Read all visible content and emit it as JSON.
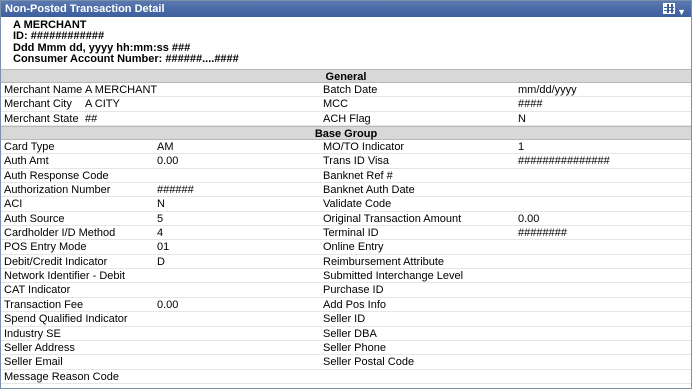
{
  "window": {
    "title": "Non-Posted Transaction Detail"
  },
  "icons": {
    "grid": "grid-icon",
    "menu": "chevron-down-icon"
  },
  "header": {
    "merchant": "A MERCHANT",
    "id_line": "ID: ############",
    "datetime": "Ddd Mmm dd, yyyy hh:mm:ss ###",
    "account_line": "Consumer Account Number: ######....####"
  },
  "general": {
    "title": "General",
    "rows": [
      {
        "l1": "Merchant Name",
        "v1": "A MERCHANT",
        "l2": "Batch Date",
        "v2": "mm/dd/yyyy"
      },
      {
        "l1": "Merchant City",
        "v1": "A CITY",
        "l2": "MCC",
        "v2": "####"
      },
      {
        "l1": "Merchant State",
        "v1": "##",
        "l2": "ACH Flag",
        "v2": "N"
      }
    ]
  },
  "base_group": {
    "title": "Base Group",
    "rows": [
      {
        "l1": "Card Type",
        "v1": "AM",
        "l2": "MO/TO Indicator",
        "v2": "1"
      },
      {
        "l1": "Auth Amt",
        "v1": "0.00",
        "l2": "Trans ID Visa",
        "v2": "###############"
      },
      {
        "l1": "Auth Response Code",
        "v1": "",
        "l2": "Banknet Ref #",
        "v2": ""
      },
      {
        "l1": "Authorization Number",
        "v1": "######",
        "l2": "Banknet Auth Date",
        "v2": ""
      },
      {
        "l1": "ACI",
        "v1": "N",
        "l2": "Validate Code",
        "v2": ""
      },
      {
        "l1": "Auth Source",
        "v1": "5",
        "l2": "Original Transaction Amount",
        "v2": "0.00"
      },
      {
        "l1": "Cardholder I/D Method",
        "v1": "4",
        "l2": "Terminal ID",
        "v2": "########"
      },
      {
        "l1": "POS Entry Mode",
        "v1": "01",
        "l2": "Online Entry",
        "v2": ""
      },
      {
        "l1": "Debit/Credit Indicator",
        "v1": "D",
        "l2": "Reimbursement Attribute",
        "v2": ""
      },
      {
        "l1": "Network Identifier - Debit",
        "v1": "",
        "l2": "Submitted Interchange Level",
        "v2": ""
      },
      {
        "l1": "CAT Indicator",
        "v1": "",
        "l2": "Purchase ID",
        "v2": ""
      },
      {
        "l1": "Transaction Fee",
        "v1": "0.00",
        "l2": "Add Pos Info",
        "v2": ""
      },
      {
        "l1": "Spend Qualified Indicator",
        "v1": "",
        "l2": "Seller ID",
        "v2": ""
      },
      {
        "l1": "Industry SE",
        "v1": "",
        "l2": "Seller DBA",
        "v2": ""
      },
      {
        "l1": "Seller Address",
        "v1": "",
        "l2": "Seller Phone",
        "v2": ""
      },
      {
        "l1": "Seller Email",
        "v1": "",
        "l2": "Seller Postal Code",
        "v2": ""
      },
      {
        "l1": "Message Reason Code",
        "v1": "",
        "l2": "",
        "v2": ""
      }
    ]
  }
}
